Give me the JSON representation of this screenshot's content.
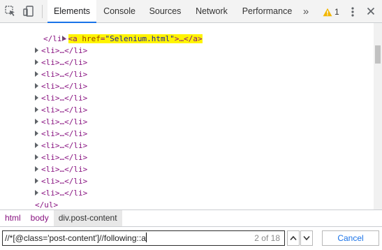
{
  "toolbar": {
    "tabs": [
      {
        "label": "Elements"
      },
      {
        "label": "Console"
      },
      {
        "label": "Sources"
      },
      {
        "label": "Network"
      },
      {
        "label": "Performance"
      }
    ],
    "overflow_label": "»",
    "warning_count": "1"
  },
  "tree": {
    "anchor_open": "<a ",
    "anchor_attr": "href",
    "anchor_eq": "=",
    "anchor_value": "\"Selenium.html\"",
    "anchor_rest": ">…</a>",
    "li_close": "</li>",
    "li_collapsed": "<li>…</li>",
    "ul_close": "</ul>"
  },
  "breadcrumbs": [
    {
      "label": "html"
    },
    {
      "label": "body"
    },
    {
      "label": "div.post-content"
    }
  ],
  "search": {
    "query": "//*[@class='post-content']//following::a",
    "count": "2 of 18",
    "cancel_label": "Cancel"
  },
  "colors": {
    "accent": "#1a73e8",
    "tag": "#881280",
    "highlight": "#fff400",
    "warning": "#f2b600"
  }
}
